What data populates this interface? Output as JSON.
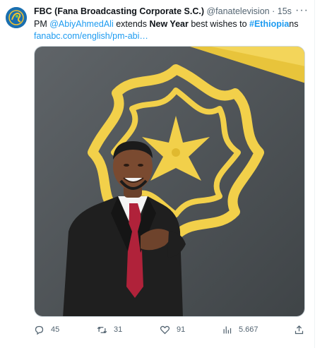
{
  "tweet": {
    "display_name": "FBC (Fana Broadcasting Corporate S.C.)",
    "handle": "@fanatelevision",
    "separator": "·",
    "time": "15s",
    "more": "···",
    "text_prefix": "PM ",
    "mention": "@AbiyAhmedAli",
    "text_mid": " extends ",
    "bold_phrase": "New Year",
    "text_mid2": " best wishes to ",
    "hashtag": "#Ethiopia",
    "text_suffix": "ns",
    "link": "fanabc.com/english/pm-abi…"
  },
  "actions": {
    "replies": "45",
    "retweets": "31",
    "likes": "91",
    "views": "5.667"
  },
  "icons": {
    "avatar": "fbc-logo",
    "reply": "reply-icon",
    "retweet": "retweet-icon",
    "like": "heart-icon",
    "views": "views-icon",
    "share": "share-icon"
  },
  "colors": {
    "link": "#1d9bf0",
    "muted": "#536471",
    "text": "#0f1419",
    "emblem": "#f2d04a"
  }
}
